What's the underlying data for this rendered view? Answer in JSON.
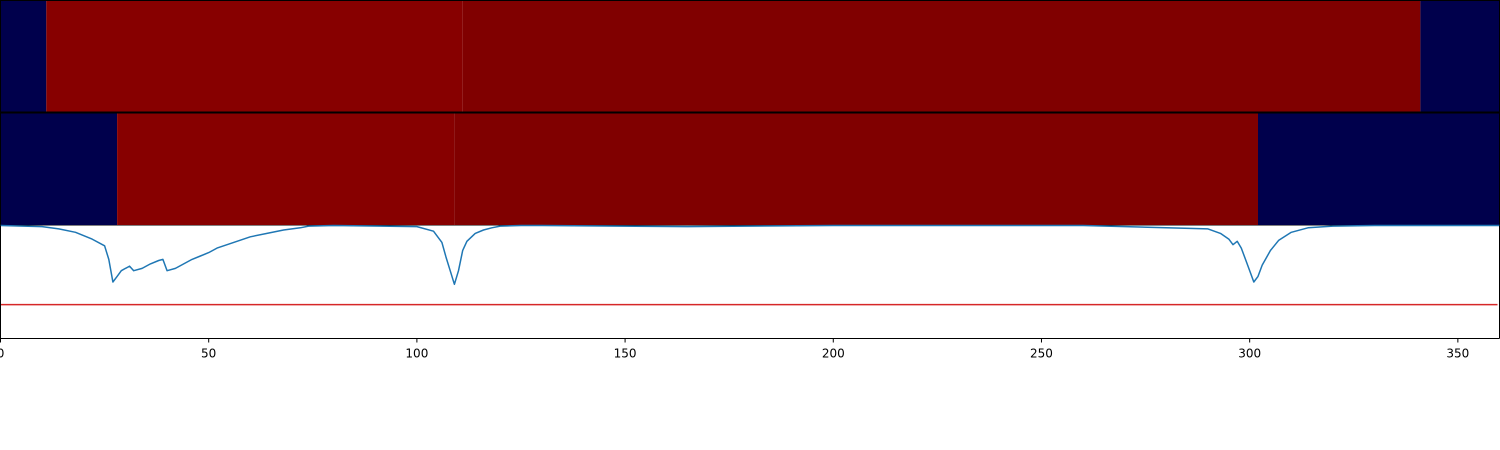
{
  "chart_data": {
    "type": "line",
    "xlim": [
      0,
      360
    ],
    "x_ticks": [
      0,
      50,
      100,
      150,
      200,
      250,
      300,
      350
    ],
    "x_tick_labels": [
      "0",
      "50",
      "100",
      "150",
      "200",
      "250",
      "300",
      "350"
    ],
    "grid": false,
    "heatmap_rows": [
      {
        "segments": [
          {
            "x0": 0,
            "x1": 11,
            "color": "#00004c"
          },
          {
            "x0": 11,
            "x1": 111,
            "color": "#870000"
          },
          {
            "x0": 111,
            "x1": 341,
            "color": "#800000"
          },
          {
            "x0": 341,
            "x1": 360,
            "color": "#00004c"
          }
        ]
      },
      {
        "segments": [
          {
            "x0": 0,
            "x1": 28,
            "color": "#00004c"
          },
          {
            "x0": 28,
            "x1": 109,
            "color": "#870000"
          },
          {
            "x0": 109,
            "x1": 302,
            "color": "#800000"
          },
          {
            "x0": 302,
            "x1": 360,
            "color": "#00004c"
          }
        ]
      }
    ],
    "line_panel": {
      "ylim": [
        0,
        1
      ],
      "series": [
        {
          "color": "#1f77b4",
          "x": [
            0,
            10,
            14,
            18,
            22,
            25,
            26,
            27,
            28,
            29,
            30,
            31,
            32,
            34,
            36,
            38,
            39,
            40,
            42,
            44,
            46,
            48,
            50,
            52,
            56,
            60,
            64,
            68,
            72,
            74,
            80,
            100,
            104,
            106,
            107,
            108,
            109,
            110,
            111,
            112,
            114,
            116,
            118,
            120,
            125,
            130,
            165,
            200,
            260,
            290,
            293,
            295,
            296,
            297,
            298,
            299,
            300,
            301,
            302,
            303,
            305,
            307,
            310,
            314,
            320,
            330,
            360
          ],
          "y": [
            1.0,
            0.99,
            0.97,
            0.94,
            0.88,
            0.82,
            0.7,
            0.5,
            0.55,
            0.6,
            0.62,
            0.64,
            0.6,
            0.62,
            0.66,
            0.69,
            0.7,
            0.6,
            0.62,
            0.66,
            0.7,
            0.73,
            0.76,
            0.8,
            0.85,
            0.9,
            0.93,
            0.96,
            0.98,
            0.995,
            1.0,
            0.99,
            0.95,
            0.85,
            0.72,
            0.6,
            0.48,
            0.6,
            0.78,
            0.86,
            0.93,
            0.96,
            0.98,
            0.995,
            1.0,
            1.0,
            0.99,
            1.0,
            1.0,
            0.97,
            0.93,
            0.88,
            0.83,
            0.86,
            0.8,
            0.7,
            0.6,
            0.5,
            0.55,
            0.65,
            0.78,
            0.87,
            0.94,
            0.98,
            0.995,
            1.0,
            1.0
          ]
        }
      ],
      "hline": {
        "y": 0.3,
        "color": "#d62728"
      }
    }
  }
}
